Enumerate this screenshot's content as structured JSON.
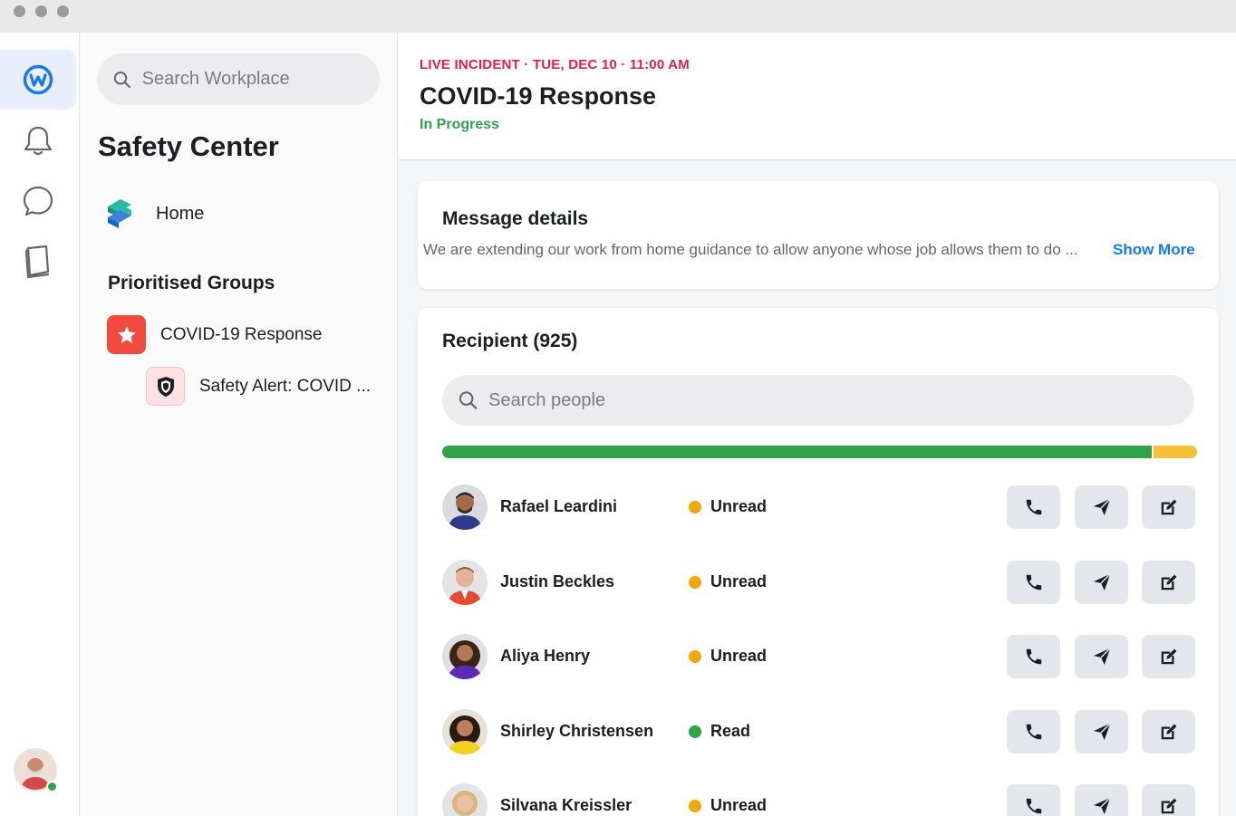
{
  "search": {
    "placeholder": "Search Workplace"
  },
  "panel": {
    "title": "Safety Center",
    "home_label": "Home",
    "groups_title": "Prioritised Groups",
    "groups": [
      {
        "label": "COVID-19 Response",
        "icon": "star-icon"
      },
      {
        "label": "Safety Alert: COVID ...",
        "icon": "shield-icon"
      }
    ]
  },
  "incident": {
    "live_label": "LIVE INCIDENT · TUE, DEC 10 · 11:00 AM",
    "title": "COVID-19 Response",
    "status": "In Progress"
  },
  "message": {
    "title": "Message details",
    "text": "We are extending our work from home guidance to allow anyone whose job allows them to do ...",
    "show_more": "Show More"
  },
  "recipients": {
    "title": "Recipient (925)",
    "search_placeholder": "Search people",
    "read_fraction": 0.942,
    "rows": [
      {
        "name": "Rafael Leardini",
        "status": "Unread"
      },
      {
        "name": "Justin Beckles",
        "status": "Unread"
      },
      {
        "name": "Aliya Henry",
        "status": "Unread"
      },
      {
        "name": "Shirley Christensen",
        "status": "Read"
      },
      {
        "name": "Silvana Kreissler",
        "status": "Unread"
      }
    ]
  },
  "colors": {
    "accent": "#1877f2",
    "live": "#e41e3f",
    "read": "#31a24c",
    "unread": "#f0a70d",
    "star_bg": "#f04b3e"
  }
}
